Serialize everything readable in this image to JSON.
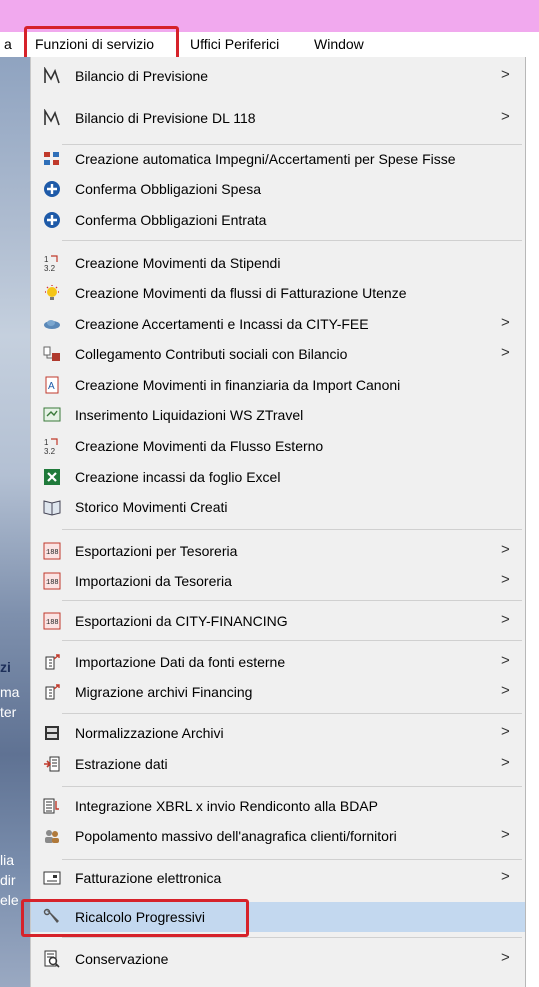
{
  "menubar": {
    "partial_left": "a",
    "items": [
      "Funzioni di servizio",
      "Uffici Periferici",
      "Window"
    ]
  },
  "background_fragments": [
    "zi",
    "ma",
    "ter",
    "lia",
    "dir",
    "ele"
  ],
  "menu": {
    "items": [
      {
        "label": "Bilancio di Previsione",
        "submenu": true,
        "icon": "chart-line-icon"
      },
      {
        "label": "Bilancio di Previsione DL 118",
        "submenu": true,
        "icon": "chart-line-icon"
      },
      {
        "label": "Creazione automatica Impegni/Accertamenti per Spese Fisse",
        "submenu": false,
        "icon": "grid-flow-icon"
      },
      {
        "label": "Conferma Obbligazioni Spesa",
        "submenu": false,
        "icon": "plus-circle-icon"
      },
      {
        "label": "Conferma Obbligazioni Entrata",
        "submenu": false,
        "icon": "plus-circle-icon"
      },
      {
        "label": "Creazione Movimenti da Stipendi",
        "submenu": false,
        "icon": "numbers-icon"
      },
      {
        "label": "Creazione Movimenti da flussi di Fatturazione Utenze",
        "submenu": false,
        "icon": "bulb-icon"
      },
      {
        "label": "Creazione Accertamenti e Incassi da CITY-FEE",
        "submenu": true,
        "icon": "cloud-icon"
      },
      {
        "label": "Collegamento Contributi sociali con Bilancio",
        "submenu": true,
        "icon": "link-docs-icon"
      },
      {
        "label": "Creazione Movimenti in finanziaria da Import Canoni",
        "submenu": false,
        "icon": "document-a-icon"
      },
      {
        "label": "Inserimento Liquidazioni WS ZTravel",
        "submenu": false,
        "icon": "travel-icon"
      },
      {
        "label": "Creazione Movimenti da Flusso Esterno",
        "submenu": false,
        "icon": "numbers-icon"
      },
      {
        "label": "Creazione incassi da foglio Excel",
        "submenu": false,
        "icon": "excel-icon"
      },
      {
        "label": "Storico Movimenti Creati",
        "submenu": false,
        "icon": "book-icon"
      },
      {
        "label": "Esportazioni per Tesoreria",
        "submenu": true,
        "icon": "calc-icon"
      },
      {
        "label": "Importazioni da Tesoreria",
        "submenu": true,
        "icon": "calc-icon"
      },
      {
        "label": "Esportazioni da CITY-FINANCING",
        "submenu": true,
        "icon": "calc-icon"
      },
      {
        "label": "Importazione Dati da fonti esterne",
        "submenu": true,
        "icon": "import-icon"
      },
      {
        "label": "Migrazione archivi Financing",
        "submenu": true,
        "icon": "import-icon"
      },
      {
        "label": "Normalizzazione Archivi",
        "submenu": true,
        "icon": "archive-icon"
      },
      {
        "label": "Estrazione dati",
        "submenu": true,
        "icon": "extract-icon"
      },
      {
        "label": "Integrazione XBRL x invio Rendiconto alla BDAP",
        "submenu": false,
        "icon": "list-arrow-icon"
      },
      {
        "label": "Popolamento massivo dell'anagrafica clienti/fornitori",
        "submenu": true,
        "icon": "people-icon"
      },
      {
        "label": "Fatturazione elettronica",
        "submenu": true,
        "icon": "invoice-icon"
      },
      {
        "label": "Ricalcolo Progressivi",
        "submenu": false,
        "icon": "wrench-icon"
      },
      {
        "label": "Conservazione",
        "submenu": true,
        "icon": "magnifier-doc-icon"
      }
    ]
  },
  "submenu_arrow": ">"
}
